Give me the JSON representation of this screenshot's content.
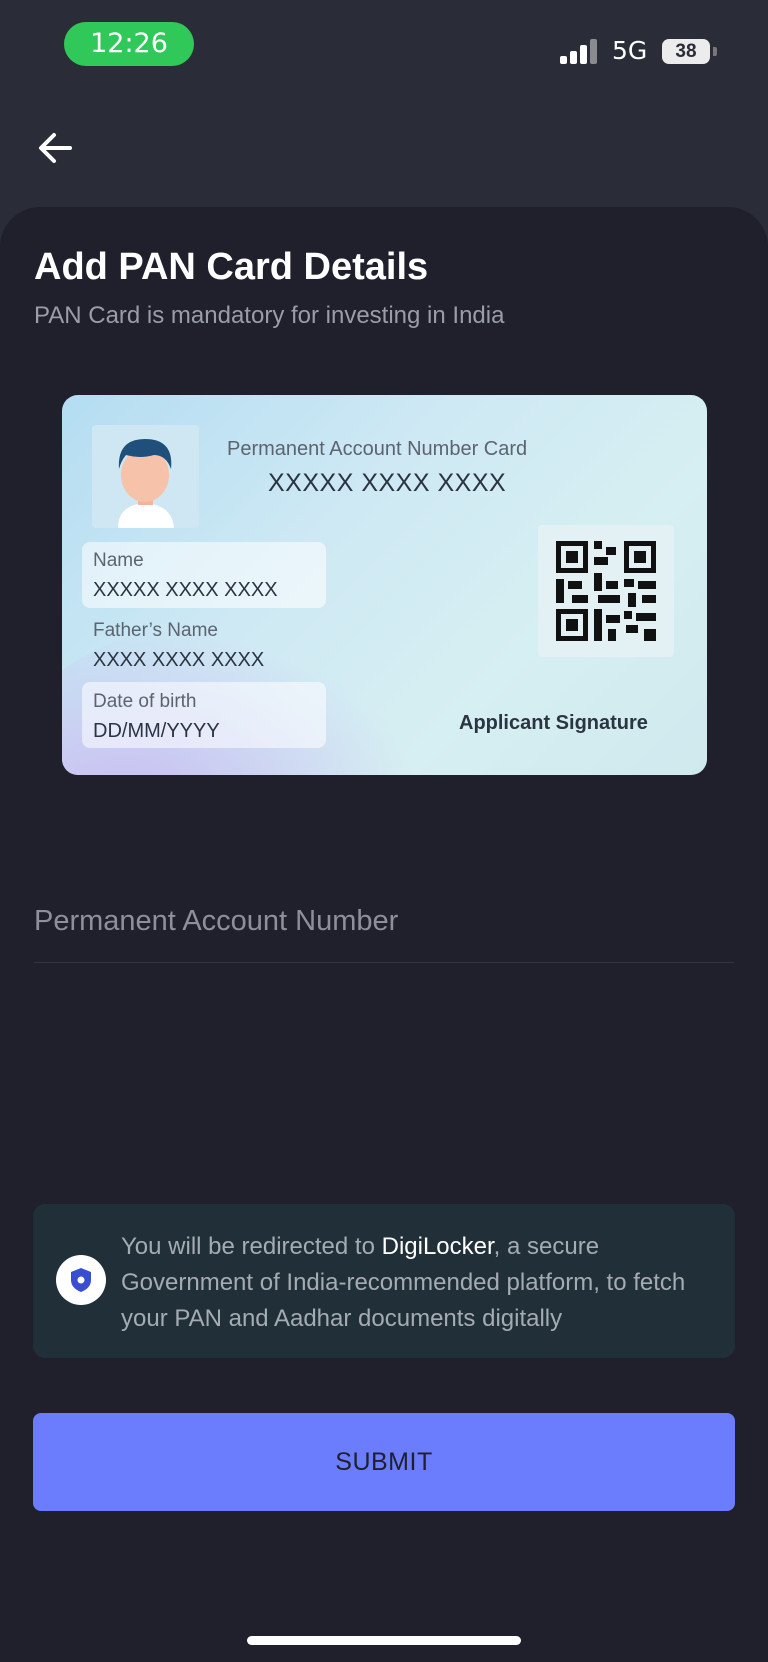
{
  "status_bar": {
    "time": "12:26",
    "network": "5G",
    "battery": "38"
  },
  "header": {
    "back_icon": "arrow-left-icon"
  },
  "page": {
    "title": "Add PAN Card Details",
    "subtitle": "PAN Card is mandatory for investing in India"
  },
  "pan_card": {
    "heading": "Permanent Account Number Card",
    "number": "XXXXX XXXX XXXX",
    "name_label": "Name",
    "name_value": "XXXXX XXXX XXXX",
    "father_label": "Father’s Name",
    "father_value": "XXXX XXXX XXXX",
    "dob_label": "Date of birth",
    "dob_value": "DD/MM/YYYY",
    "signature_label": "Applicant Signature",
    "icons": [
      "avatar-icon",
      "qr-code-icon"
    ]
  },
  "form": {
    "pan_placeholder": "Permanent Account Number",
    "pan_value": ""
  },
  "info": {
    "text_before": "You will be redirected to ",
    "highlight": "DigiLocker",
    "text_after": ", a secure Government of India-recommended platform, to fetch your PAN and Aadhar documents digitally",
    "icon": "shield-icon"
  },
  "actions": {
    "submit_label": "SUBMIT"
  },
  "colors": {
    "background": "#2a2c37",
    "sheet": "#1f202c",
    "accent": "#6b7cfc",
    "time_pill": "#31c85a",
    "info_bg": "#213038"
  }
}
